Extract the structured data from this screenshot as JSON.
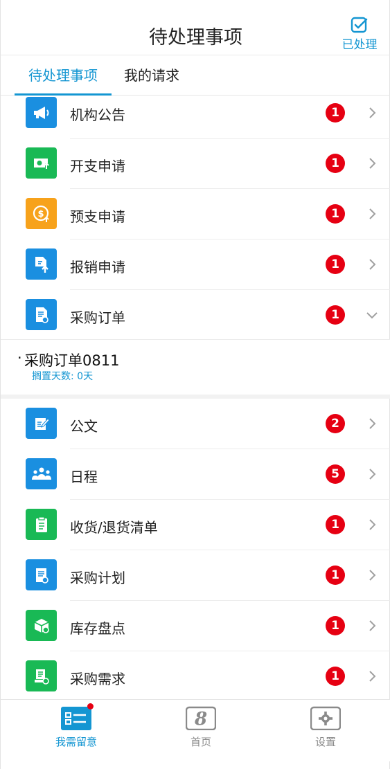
{
  "header": {
    "title": "待处理事项",
    "done_label": "已处理"
  },
  "tabs": [
    {
      "label": "待处理事项",
      "active": true
    },
    {
      "label": "我的请求",
      "active": false
    }
  ],
  "items": [
    {
      "label": "机构公告",
      "badge": "1",
      "icon": "megaphone-icon",
      "color": "#1a8fe0"
    },
    {
      "label": "开支申请",
      "badge": "1",
      "icon": "money-upload-icon",
      "color": "#19b955"
    },
    {
      "label": "预支申请",
      "badge": "1",
      "icon": "dollar-coin-icon",
      "color": "#f7a21b"
    },
    {
      "label": "报销申请",
      "badge": "1",
      "icon": "document-upload-icon",
      "color": "#1a8fe0"
    },
    {
      "label": "采购订单",
      "badge": "1",
      "icon": "order-document-icon",
      "color": "#1a8fe0",
      "expanded": true
    },
    {
      "label": "公文",
      "badge": "2",
      "icon": "edit-document-icon",
      "color": "#1a8fe0"
    },
    {
      "label": "日程",
      "badge": "5",
      "icon": "people-icon",
      "color": "#1a8fe0"
    },
    {
      "label": "收货/退货清单",
      "badge": "1",
      "icon": "clipboard-icon",
      "color": "#19b955"
    },
    {
      "label": "采购计划",
      "badge": "1",
      "icon": "plan-document-icon",
      "color": "#1a8fe0"
    },
    {
      "label": "库存盘点",
      "badge": "1",
      "icon": "box-icon",
      "color": "#19b955"
    },
    {
      "label": "采购需求",
      "badge": "1",
      "icon": "request-document-icon",
      "color": "#19b955"
    }
  ],
  "expanded_order": {
    "title": "采购订单0811",
    "subtitle": "搁置天数: 0天"
  },
  "tabbar": [
    {
      "label": "我需留意",
      "icon": "list-icon",
      "active": true
    },
    {
      "label": "首页",
      "icon": "home-8-icon",
      "active": false
    },
    {
      "label": "设置",
      "icon": "gear-icon",
      "active": false
    }
  ]
}
